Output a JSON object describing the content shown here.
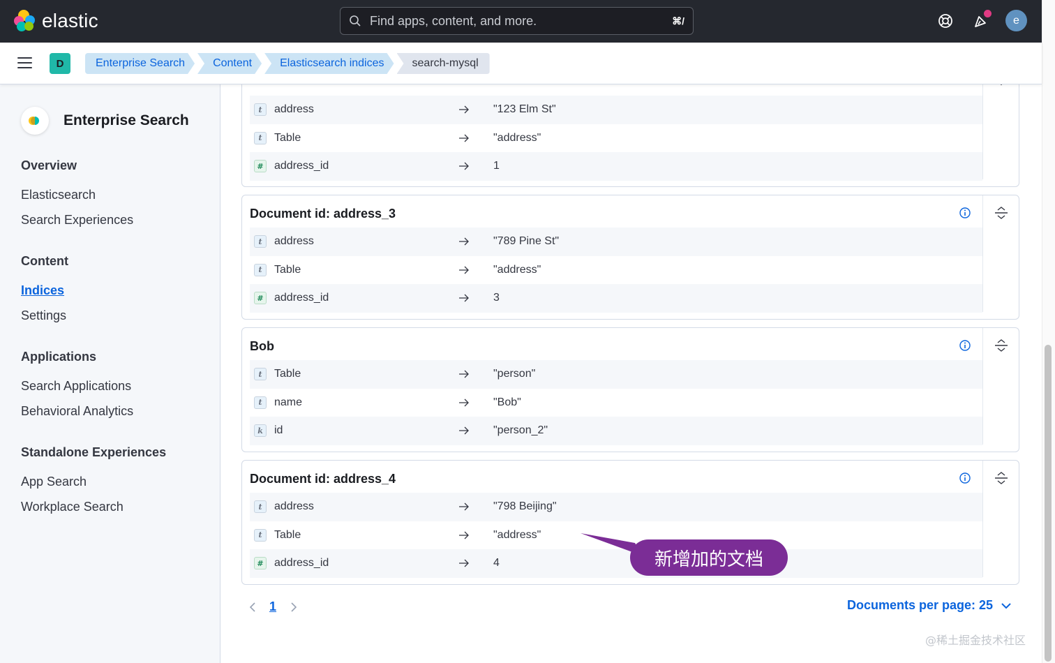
{
  "header": {
    "logo_text": "elastic",
    "search_placeholder": "Find apps, content, and more.",
    "search_shortcut": "⌘/",
    "avatar_initial": "e"
  },
  "breadcrumbs": {
    "space_initial": "D",
    "items": [
      "Enterprise Search",
      "Content",
      "Elasticsearch indices",
      "search-mysql"
    ]
  },
  "sidebar": {
    "title": "Enterprise Search",
    "groups": [
      {
        "heading": "Overview",
        "items": [
          "Elasticsearch",
          "Search Experiences"
        ]
      },
      {
        "heading": "Content",
        "items": [
          "Indices",
          "Settings"
        ],
        "active": "Indices"
      },
      {
        "heading": "Applications",
        "items": [
          "Search Applications",
          "Behavioral Analytics"
        ]
      },
      {
        "heading": "Standalone Experiences",
        "items": [
          "App Search",
          "Workplace Search"
        ]
      }
    ]
  },
  "documents": [
    {
      "title": "",
      "fields": [
        {
          "type": "t",
          "name": "address",
          "value": "\"123 Elm St\""
        },
        {
          "type": "t",
          "name": "Table",
          "value": "\"address\""
        },
        {
          "type": "#",
          "name": "address_id",
          "value": "1"
        }
      ]
    },
    {
      "title": "Document id: address_3",
      "fields": [
        {
          "type": "t",
          "name": "address",
          "value": "\"789 Pine St\""
        },
        {
          "type": "t",
          "name": "Table",
          "value": "\"address\""
        },
        {
          "type": "#",
          "name": "address_id",
          "value": "3"
        }
      ]
    },
    {
      "title": "Bob",
      "fields": [
        {
          "type": "t",
          "name": "Table",
          "value": "\"person\""
        },
        {
          "type": "t",
          "name": "name",
          "value": "\"Bob\""
        },
        {
          "type": "k",
          "name": "id",
          "value": "\"person_2\""
        }
      ]
    },
    {
      "title": "Document id: address_4",
      "fields": [
        {
          "type": "t",
          "name": "address",
          "value": "\"798 Beijing\""
        },
        {
          "type": "t",
          "name": "Table",
          "value": "\"address\""
        },
        {
          "type": "#",
          "name": "address_id",
          "value": "4"
        }
      ]
    }
  ],
  "pagination": {
    "current_page": "1",
    "per_page_label": "Documents per page: 25"
  },
  "annotation": {
    "callout_text": "新增加的文档"
  },
  "watermark": "@稀土掘金技术社区",
  "colors": {
    "header_bg": "#25282f",
    "link_blue": "#0b64dd",
    "callout_purple": "#7b2d96",
    "space_badge": "#20b8a8"
  }
}
